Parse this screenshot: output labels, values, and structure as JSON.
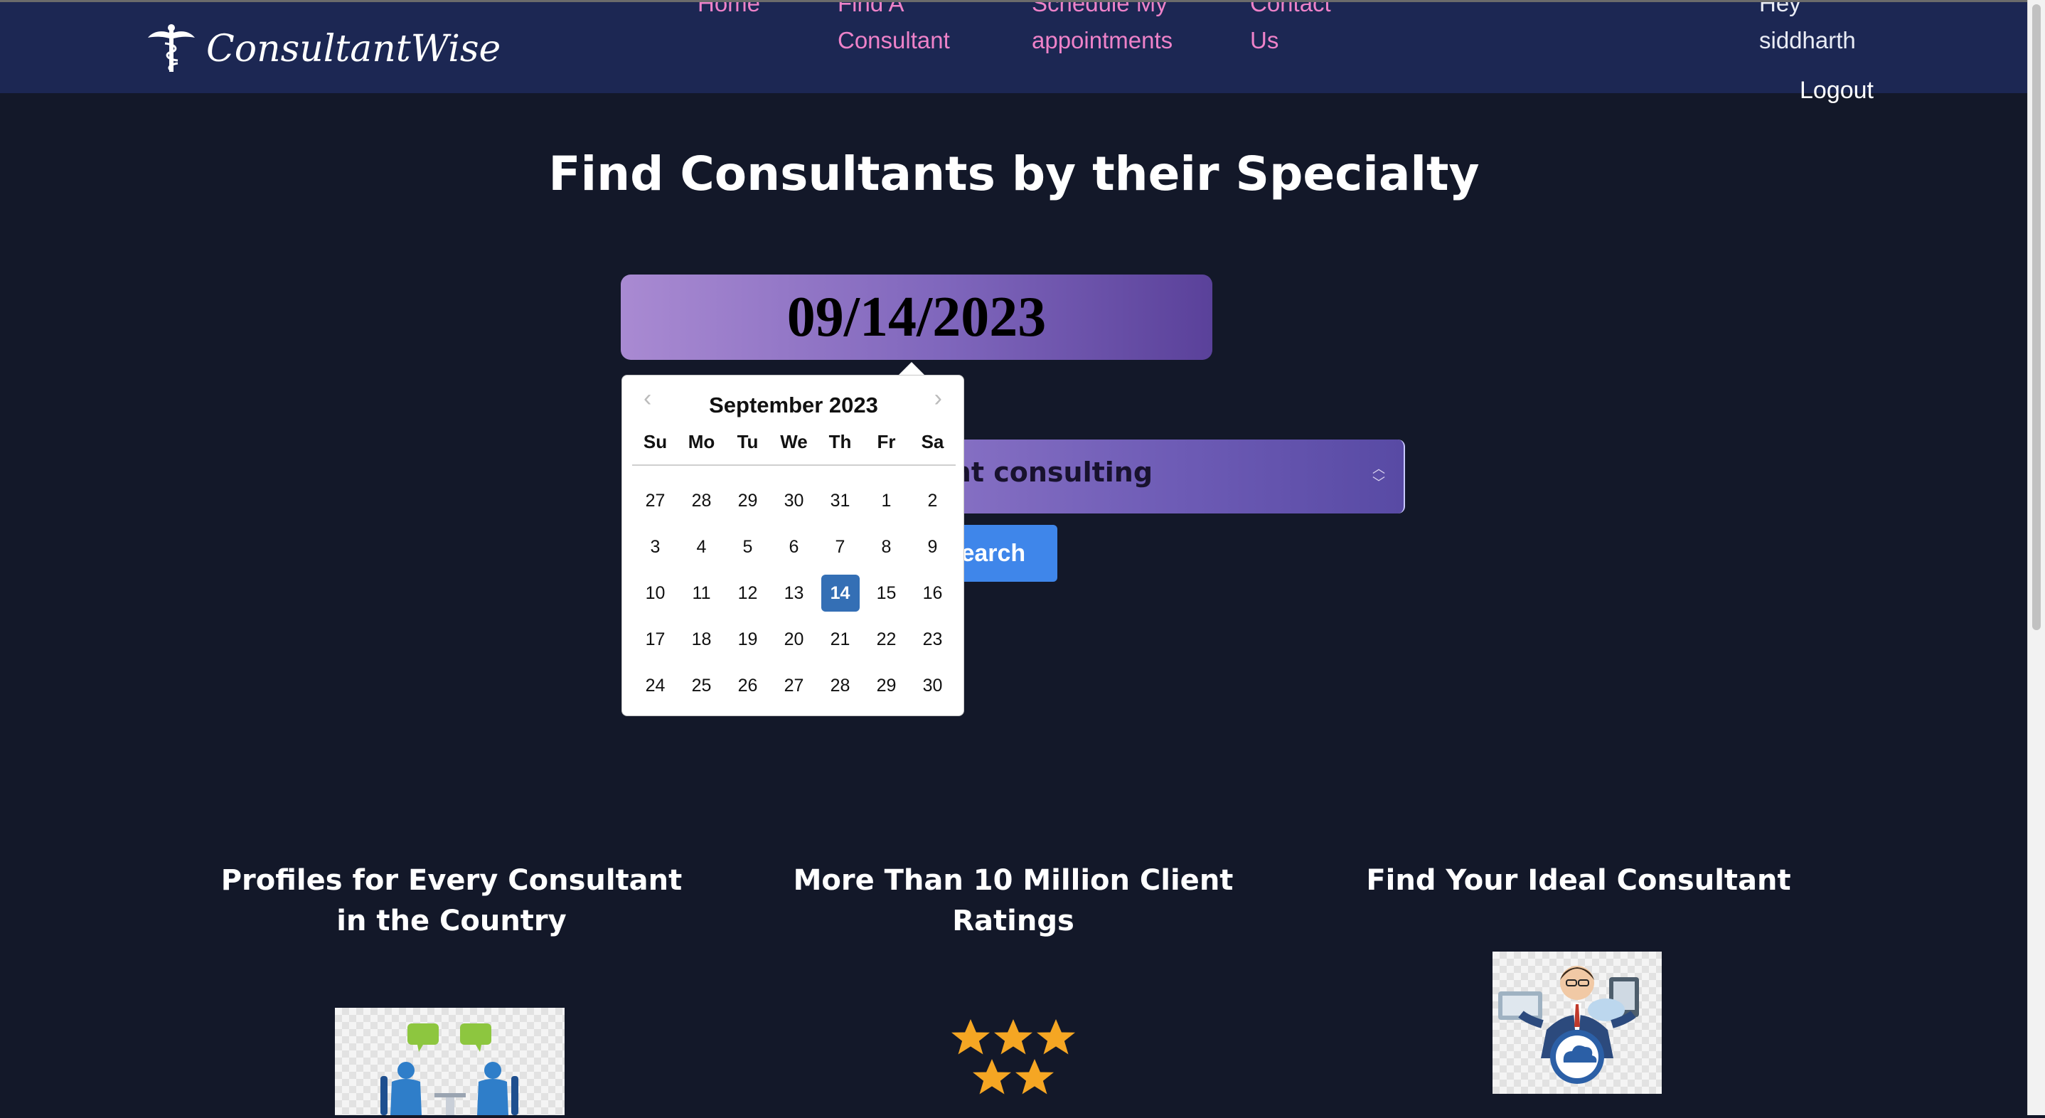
{
  "header": {
    "brand": "ConsultantWise",
    "nav": {
      "home": [
        "Home"
      ],
      "find": [
        "Find A",
        "Consultant"
      ],
      "schedule": [
        "Schedule My",
        "appointments"
      ],
      "contact": [
        "Contact",
        "Us"
      ]
    },
    "greeting": [
      "Hey",
      "siddharth"
    ],
    "logout_label": "Logout"
  },
  "main": {
    "title": "Find Consultants by their Specialty",
    "date_value": "09/14/2023",
    "specialty_visible_text": "ent consulting",
    "search_visible_label": "Search"
  },
  "datepicker": {
    "month_label": "September 2023",
    "prev_icon": "chevron-left-icon",
    "next_icon": "chevron-right-icon",
    "weekdays": [
      "Su",
      "Mo",
      "Tu",
      "We",
      "Th",
      "Fr",
      "Sa"
    ],
    "weeks": [
      [
        "27",
        "28",
        "29",
        "30",
        "31",
        "1",
        "2"
      ],
      [
        "3",
        "4",
        "5",
        "6",
        "7",
        "8",
        "9"
      ],
      [
        "10",
        "11",
        "12",
        "13",
        "14",
        "15",
        "16"
      ],
      [
        "17",
        "18",
        "19",
        "20",
        "21",
        "22",
        "23"
      ],
      [
        "24",
        "25",
        "26",
        "27",
        "28",
        "29",
        "30"
      ]
    ],
    "selected_day": "14",
    "selected_color": "#346fb5"
  },
  "features": [
    {
      "heading": "Profiles for Every Consultant in the Country",
      "image": "consultant-meeting-illustration"
    },
    {
      "heading": "More Than 10 Million Client Ratings",
      "image": "five-stars-illustration"
    },
    {
      "heading": "Find Your Ideal Consultant",
      "image": "consultant-cloud-illustration"
    }
  ],
  "colors": {
    "page_bg": "#131829",
    "navbar_bg": "#1c2753",
    "nav_link": "#ee82c9",
    "search_button": "#3f86ea",
    "field_gradient_start": "#a98ad2",
    "field_gradient_end": "#5a419a"
  }
}
